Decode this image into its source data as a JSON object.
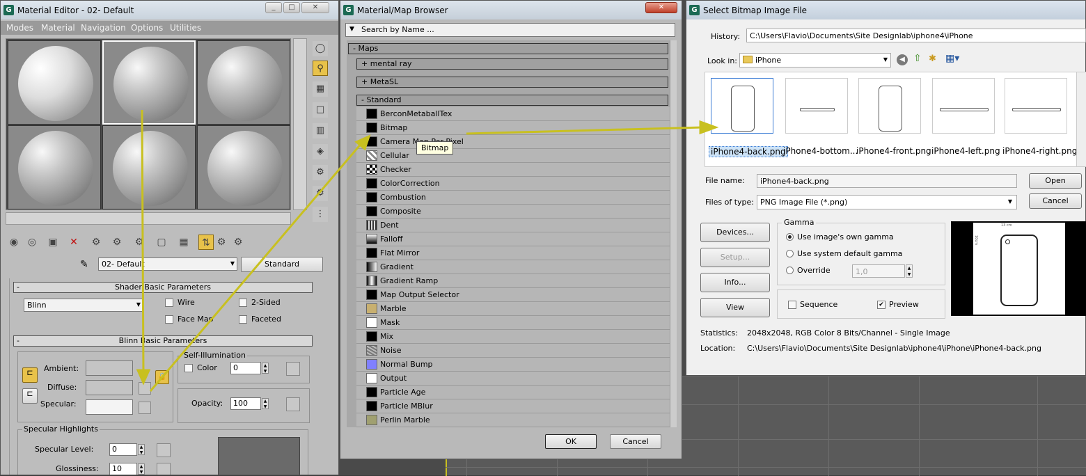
{
  "material_editor": {
    "title": "Material Editor - 02- Default",
    "menu": [
      "Modes",
      "Material",
      "Navigation",
      "Options",
      "Utilities"
    ],
    "material_name": "02- Default",
    "material_type": "Standard",
    "shader_rollout": "Shader Basic Parameters",
    "shader": "Blinn",
    "checks": {
      "wire": "Wire",
      "two_sided": "2-Sided",
      "face_map": "Face Map",
      "faceted": "Faceted"
    },
    "blinn_rollout": "Blinn Basic Parameters",
    "self_illum_title": "Self-Illumination",
    "color_label": "Color",
    "self_illum_value": "0",
    "ambient_label": "Ambient:",
    "diffuse_label": "Diffuse:",
    "specular_label": "Specular:",
    "opacity_label": "Opacity:",
    "opacity_value": "100",
    "spec_highlights_title": "Specular Highlights",
    "spec_level_label": "Specular Level:",
    "spec_level_value": "0",
    "glossiness_label": "Glossiness:",
    "glossiness_value": "10",
    "window_buttons": {
      "minimize": "_",
      "maximize": "□",
      "close": "✕"
    }
  },
  "map_browser": {
    "title": "Material/Map Browser",
    "search_placeholder": "Search by Name ...",
    "groups": {
      "maps": "Maps",
      "mental_ray": "mental ray",
      "metasl": "MetaSL",
      "standard": "Standard"
    },
    "items": [
      "BerconMetaballTex",
      "Bitmap",
      "Camera Map Per Pixel",
      "Cellular",
      "Checker",
      "ColorCorrection",
      "Combustion",
      "Composite",
      "Dent",
      "Falloff",
      "Flat Mirror",
      "Gradient",
      "Gradient Ramp",
      "Map Output Selector",
      "Marble",
      "Mask",
      "Mix",
      "Noise",
      "Normal Bump",
      "Output",
      "Particle Age",
      "Particle MBlur",
      "Perlin Marble"
    ],
    "tooltip": "Bitmap",
    "ok": "OK",
    "cancel": "Cancel",
    "close": "✕"
  },
  "bitmap_dialog": {
    "title": "Select Bitmap Image File",
    "history_label": "History:",
    "history_value": "C:\\Users\\Flavio\\Documents\\Site Designlab\\iphone4\\iPhone",
    "lookin_label": "Look in:",
    "lookin_value": "iPhone",
    "files": [
      "iPhone4-back.png",
      "iPhone4-bottom...",
      "iPhone4-front.png",
      "iPhone4-left.png",
      "iPhone4-right.png"
    ],
    "filename_label": "File name:",
    "filename_value": "iPhone4-back.png",
    "filetype_label": "Files of type:",
    "filetype_value": "PNG Image File (*.png)",
    "open": "Open",
    "cancel": "Cancel",
    "devices": "Devices...",
    "setup": "Setup...",
    "info": "Info...",
    "view": "View",
    "gamma_title": "Gamma",
    "gamma_own": "Use image's own gamma",
    "gamma_system": "Use system default gamma",
    "gamma_override": "Override",
    "override_value": "1,0",
    "sequence": "Sequence",
    "preview": "Preview",
    "statistics_label": "Statistics:",
    "statistics_value": "2048x2048, RGB Color 8 Bits/Channel - Single Image",
    "location_label": "Location:",
    "location_value": "C:\\Users\\Flavio\\Documents\\Site Designlab\\iphone4\\iPhone\\iPhone4-back.png",
    "preview_ruler": "13 cm",
    "preview_ruler_v": "10cm",
    "colors": {
      "selection": "#cde3f7",
      "arrow": "#c8c020"
    }
  }
}
